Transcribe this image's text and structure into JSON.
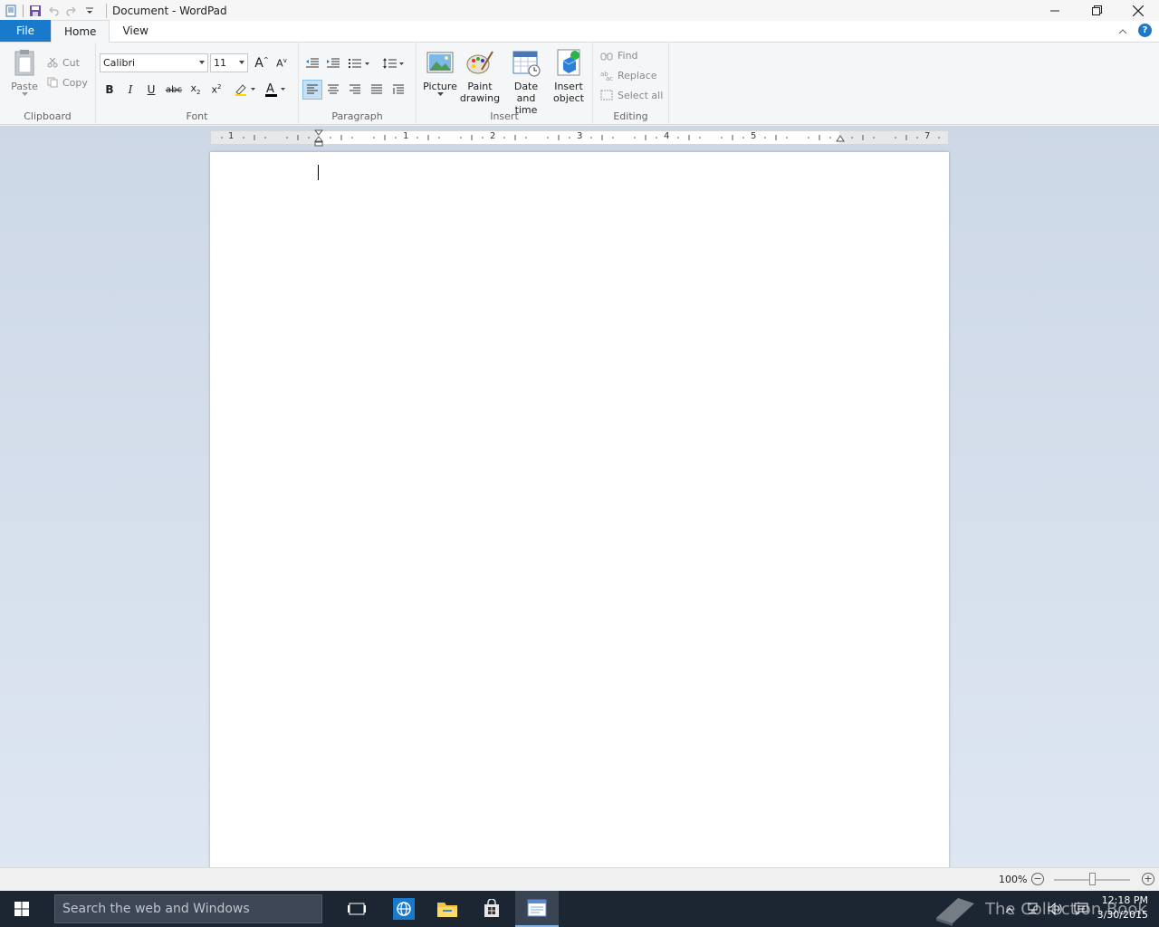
{
  "window": {
    "title": "Document - WordPad"
  },
  "tabs": {
    "file": "File",
    "home": "Home",
    "view": "View"
  },
  "clipboard": {
    "paste": "Paste",
    "cut": "Cut",
    "copy": "Copy",
    "label": "Clipboard"
  },
  "font": {
    "family": "Calibri",
    "size": "11",
    "label": "Font"
  },
  "paragraph": {
    "label": "Paragraph"
  },
  "insert": {
    "picture": "Picture",
    "paint_drawing_1": "Paint",
    "paint_drawing_2": "drawing",
    "date_time_1": "Date and",
    "date_time_2": "time",
    "insert_object_1": "Insert",
    "insert_object_2": "object",
    "label": "Insert"
  },
  "editing": {
    "find": "Find",
    "replace": "Replace",
    "select_all": "Select all",
    "label": "Editing"
  },
  "ruler": {
    "numbers": [
      "1",
      "1",
      "2",
      "3",
      "4",
      "5",
      "7"
    ]
  },
  "status": {
    "zoom": "100%"
  },
  "taskbar": {
    "search_placeholder": "Search the web and Windows",
    "watermark": "The Collection Book",
    "time": "12:18 PM",
    "date": "3/30/2015"
  },
  "colors": {
    "file_tab": "#1979ca",
    "taskbar": "#1c2532"
  }
}
